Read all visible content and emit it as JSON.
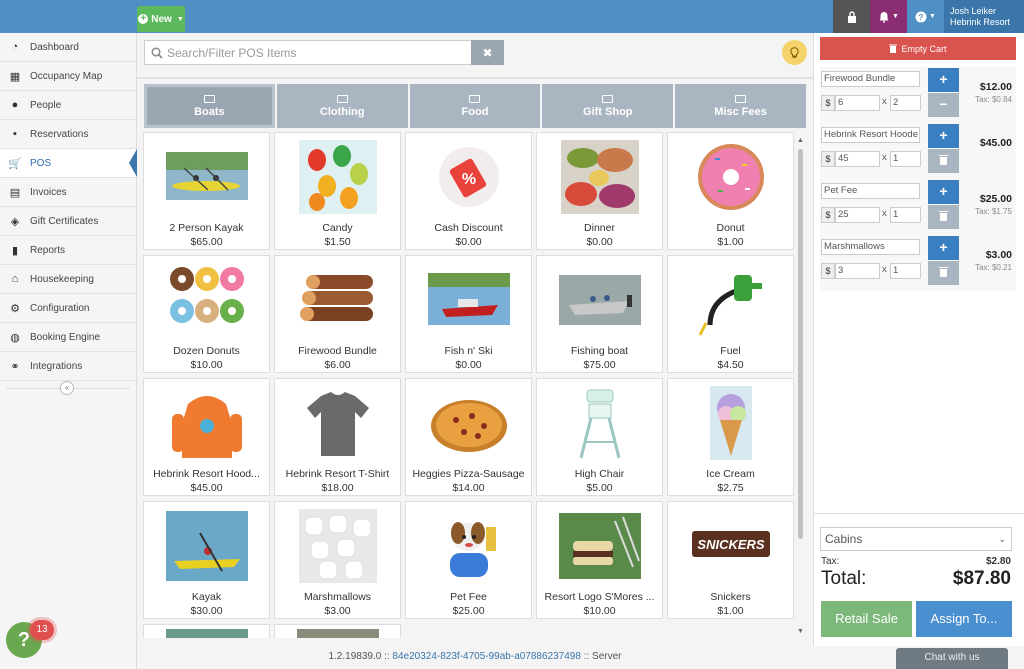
{
  "topbar": {
    "new_label": "New",
    "user_name": "Josh Leiker",
    "user_property": "Hebrink Resort"
  },
  "sidebar": {
    "items": [
      {
        "label": "Dashboard",
        "icon": "dashboard-icon"
      },
      {
        "label": "Occupancy Map",
        "icon": "calendar-icon"
      },
      {
        "label": "People",
        "icon": "user-icon"
      },
      {
        "label": "Reservations",
        "icon": "briefcase-icon"
      },
      {
        "label": "POS",
        "icon": "cart-icon",
        "active": true
      },
      {
        "label": "Invoices",
        "icon": "table-icon"
      },
      {
        "label": "Gift Certificates",
        "icon": "tag-icon"
      },
      {
        "label": "Reports",
        "icon": "bar-chart-icon"
      },
      {
        "label": "Housekeeping",
        "icon": "home-icon"
      },
      {
        "label": "Configuration",
        "icon": "gears-icon"
      },
      {
        "label": "Booking Engine",
        "icon": "globe-icon"
      },
      {
        "label": "Integrations",
        "icon": "handshake-icon"
      }
    ]
  },
  "search": {
    "placeholder": "Search/Filter POS Items"
  },
  "categories": [
    "Boats",
    "Clothing",
    "Food",
    "Gift Shop",
    "Misc Fees"
  ],
  "products": [
    {
      "name": "2 Person Kayak",
      "price": "$65.00"
    },
    {
      "name": "Candy",
      "price": "$1.50"
    },
    {
      "name": "Cash Discount",
      "price": "$0.00"
    },
    {
      "name": "Dinner",
      "price": "$0.00"
    },
    {
      "name": "Donut",
      "price": "$1.00"
    },
    {
      "name": "Dozen Donuts",
      "price": "$10.00"
    },
    {
      "name": "Firewood Bundle",
      "price": "$6.00"
    },
    {
      "name": "Fish n' Ski",
      "price": "$0.00"
    },
    {
      "name": "Fishing boat",
      "price": "$75.00"
    },
    {
      "name": "Fuel",
      "price": "$4.50"
    },
    {
      "name": "Hebrink Resort Hood...",
      "price": "$45.00"
    },
    {
      "name": "Hebrink Resort T-Shirt",
      "price": "$18.00"
    },
    {
      "name": "Heggies Pizza-Sausage",
      "price": "$14.00"
    },
    {
      "name": "High Chair",
      "price": "$5.00"
    },
    {
      "name": "Ice Cream",
      "price": "$2.75"
    },
    {
      "name": "Kayak",
      "price": "$30.00"
    },
    {
      "name": "Marshmallows",
      "price": "$3.00"
    },
    {
      "name": "Pet Fee",
      "price": "$25.00"
    },
    {
      "name": "Resort Logo S'Mores ...",
      "price": "$10.00"
    },
    {
      "name": "Snickers",
      "price": "$1.00"
    }
  ],
  "cart": {
    "empty_label": "Empty Cart",
    "lines": [
      {
        "name": "Firewood Bundle",
        "currency": "$",
        "price": "6",
        "x": "x",
        "qty": "2",
        "total": "$12.00",
        "tax": "Tax: $0.84"
      },
      {
        "name": "Hebrink Resort Hoode",
        "currency": "$",
        "price": "45",
        "x": "x",
        "qty": "1",
        "total": "$45.00",
        "tax": ""
      },
      {
        "name": "Pet Fee",
        "currency": "$",
        "price": "25",
        "x": "x",
        "qty": "1",
        "total": "$25.00",
        "tax": "Tax: $1.75"
      },
      {
        "name": "Marshmallows",
        "currency": "$",
        "price": "3",
        "x": "x",
        "qty": "1",
        "total": "$3.00",
        "tax": "Tax: $0.21"
      }
    ],
    "location": "Cabins",
    "tax_label": "Tax:",
    "tax_value": "$2.80",
    "total_label": "Total:",
    "total_value": "$87.80",
    "retail_label": "Retail Sale",
    "assign_label": "Assign To..."
  },
  "footer": {
    "version": "1.2.19839.0 ::",
    "hash": "84e20324-823f-4705-99ab-a07886237498",
    "server": ":: Server"
  },
  "chat_label": "Chat with us",
  "help_badge": "13",
  "help_glyph": "?"
}
